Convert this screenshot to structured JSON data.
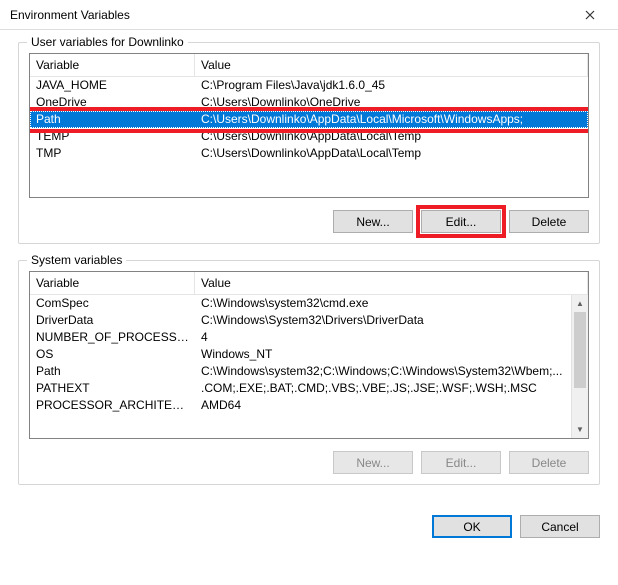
{
  "window": {
    "title": "Environment Variables"
  },
  "user_section": {
    "legend": "User variables for Downlinko",
    "columns": {
      "var": "Variable",
      "val": "Value"
    },
    "rows": [
      {
        "var": "JAVA_HOME",
        "val": "C:\\Program Files\\Java\\jdk1.6.0_45"
      },
      {
        "var": "OneDrive",
        "val": "C:\\Users\\Downlinko\\OneDrive"
      },
      {
        "var": "Path",
        "val": "C:\\Users\\Downlinko\\AppData\\Local\\Microsoft\\WindowsApps;"
      },
      {
        "var": "TEMP",
        "val": "C:\\Users\\Downlinko\\AppData\\Local\\Temp"
      },
      {
        "var": "TMP",
        "val": "C:\\Users\\Downlinko\\AppData\\Local\\Temp"
      }
    ],
    "selected_index": 2,
    "buttons": {
      "new": "New...",
      "edit": "Edit...",
      "delete": "Delete"
    }
  },
  "system_section": {
    "legend": "System variables",
    "columns": {
      "var": "Variable",
      "val": "Value"
    },
    "rows": [
      {
        "var": "ComSpec",
        "val": "C:\\Windows\\system32\\cmd.exe"
      },
      {
        "var": "DriverData",
        "val": "C:\\Windows\\System32\\Drivers\\DriverData"
      },
      {
        "var": "NUMBER_OF_PROCESSORS",
        "val": "4"
      },
      {
        "var": "OS",
        "val": "Windows_NT"
      },
      {
        "var": "Path",
        "val": "C:\\Windows\\system32;C:\\Windows;C:\\Windows\\System32\\Wbem;..."
      },
      {
        "var": "PATHEXT",
        "val": ".COM;.EXE;.BAT;.CMD;.VBS;.VBE;.JS;.JSE;.WSF;.WSH;.MSC"
      },
      {
        "var": "PROCESSOR_ARCHITECTURE",
        "val": "AMD64"
      }
    ],
    "buttons": {
      "new": "New...",
      "edit": "Edit...",
      "delete": "Delete"
    }
  },
  "dialog_buttons": {
    "ok": "OK",
    "cancel": "Cancel"
  }
}
